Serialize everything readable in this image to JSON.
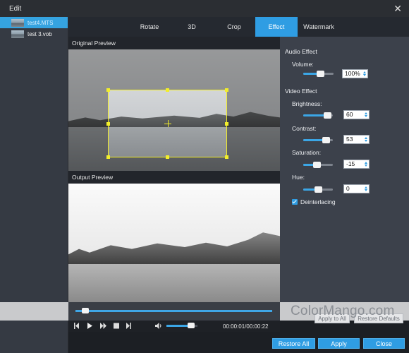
{
  "window": {
    "title": "Edit",
    "close_glyph": "✕"
  },
  "files": [
    {
      "name": "test4.MTS",
      "selected": true
    },
    {
      "name": "test 3.vob",
      "selected": false
    }
  ],
  "tabs": [
    {
      "label": "Rotate",
      "active": false
    },
    {
      "label": "3D",
      "active": false
    },
    {
      "label": "Crop",
      "active": false
    },
    {
      "label": "Effect",
      "active": true
    },
    {
      "label": "Watermark",
      "active": false
    }
  ],
  "previews": {
    "original_label": "Original Preview",
    "output_label": "Output Preview"
  },
  "effects": {
    "audio_heading": "Audio Effect",
    "volume": {
      "label": "Volume:",
      "value": "100%",
      "level": 0.55
    },
    "video_heading": "Video Effect",
    "brightness": {
      "label": "Brightness:",
      "value": "60",
      "level": 0.8
    },
    "contrast": {
      "label": "Contrast:",
      "value": "53",
      "level": 0.76
    },
    "saturation": {
      "label": "Saturation:",
      "value": "-15",
      "level": 0.45
    },
    "hue": {
      "label": "Hue:",
      "value": "0",
      "level": 0.5
    },
    "deinterlacing": {
      "label": "Deinterlacing",
      "checked": true
    }
  },
  "actions": {
    "apply_to_all": "Apply to All",
    "restore_defaults": "Restore Defaults",
    "restore_all": "Restore All",
    "apply": "Apply",
    "close": "Close"
  },
  "player": {
    "time": "00:00:01/00:00:22",
    "progress": 0.05,
    "volume_level": 0.8
  },
  "watermark": "ColorMango.com",
  "colors": {
    "accent": "#2f9de3",
    "crop_frame": "#f2ee2a"
  }
}
